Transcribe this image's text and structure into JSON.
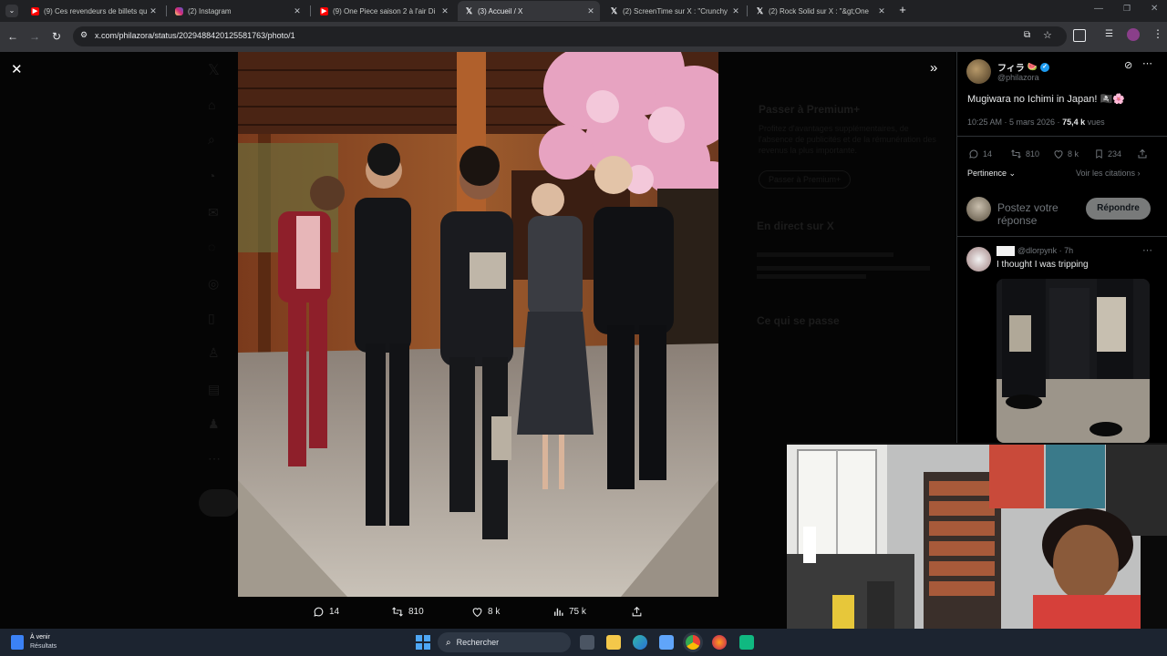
{
  "browser": {
    "tabs": [
      {
        "title": "(9) Ces revendeurs de billets qu",
        "favicon": "youtube-icon",
        "color": "#ff0000"
      },
      {
        "title": "(2) Instagram",
        "favicon": "instagram-icon",
        "color": "#d62976"
      },
      {
        "title": "(9) One Piece saison 2 à l'air Di",
        "favicon": "youtube-icon",
        "color": "#ff0000"
      },
      {
        "title": "(3) Accueil / X",
        "favicon": "x-icon",
        "color": "#000000"
      },
      {
        "title": "(2) ScreenTime sur X : \"Crunchy",
        "favicon": "x-icon",
        "color": "#000000"
      },
      {
        "title": "(2) Rock Solid sur X : \"&gt;One",
        "favicon": "x-icon",
        "color": "#000000"
      }
    ],
    "url": "x.com/philazora/status/2029488420125581763/photo/1"
  },
  "actions": {
    "replies": "14",
    "reposts": "810",
    "likes": "8 k",
    "views": "75 k"
  },
  "post": {
    "author_name": "フィラ",
    "author_emoji": "🍉",
    "handle": "@philazora",
    "text": "Mugiwara no Ichimi in Japan! 🏴‍☠️🌸",
    "time": "10:25 AM · 5 mars 2026 · ",
    "views_count": "75,4 k",
    "views_label": " vues",
    "stats": {
      "replies": "14",
      "reposts": "810",
      "likes": "8 k",
      "bookmarks": "234"
    },
    "sort_label": "Pertinence",
    "quotes_link": "Voir les citations",
    "reply_placeholder": "Postez votre réponse",
    "reply_button": "Répondre"
  },
  "reply": {
    "handle": "@dlorpynk · 7h",
    "text": "I thought I was tripping"
  },
  "background_ghost": {
    "premium_title": "Passer à Premium+",
    "premium_body": "Profitez d'avantages supplémentaires, de l'absence de publicités et de la rémunération des revenus la plus importante.",
    "premium_button": "Passer à Premium+",
    "live_title": "En direct sur X",
    "happening_title": "Ce qui se passe"
  },
  "taskbar": {
    "weather_title": "À venir",
    "weather_sub": "Résultats",
    "search_label": "Rechercher"
  },
  "colors": {
    "accent": "#1d9bf0",
    "tab_bar": "#202124",
    "address_bar": "#35363a",
    "taskbar": "#1c2430"
  }
}
